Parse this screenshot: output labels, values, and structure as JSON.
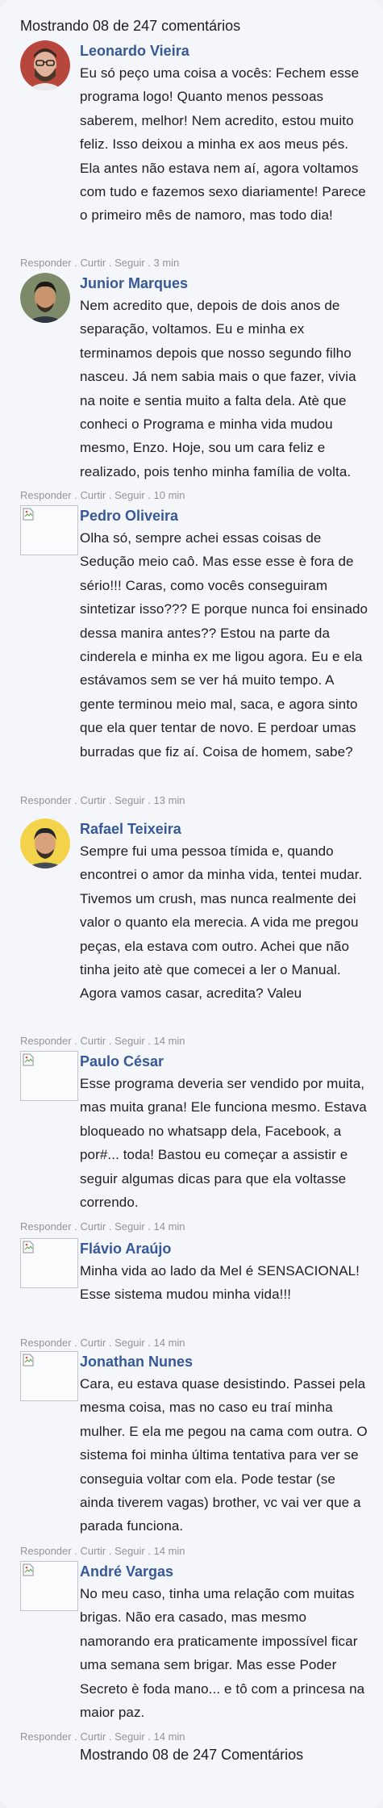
{
  "header": {
    "text": "Mostrando 08 de 247 comentários"
  },
  "footer": {
    "text": "Mostrando 08 de 247 Comentários"
  },
  "meta_actions": {
    "reply": "Responder",
    "like": "Curtir",
    "follow": "Seguir",
    "sep": " . "
  },
  "comments": [
    {
      "name": "Leonardo Vieira",
      "avatar": "photo-man-glasses-beard",
      "text": "Eu só peço uma coisa a vocês: Fechem esse programa logo! Quanto menos pessoas saberem, melhor! Nem acredito, estou muito feliz. Isso deixou a minha ex aos meus pés. Ela antes não estava nem aí, agora voltamos com tudo e fazemos sexo diariamente! Parece o primeiro mês de namoro, mas todo dia!",
      "time": "3 min"
    },
    {
      "name": "Junior Marques",
      "avatar": "photo-man-dark-hair",
      "text": "Nem acredito que, depois de dois anos de separação, voltamos. Eu e minha ex terminamos depois que nosso segundo filho nasceu. Já nem sabia mais o que fazer, vivia na noite e sentia muito a falta dela. Atè que conheci o Programa e minha vida mudou mesmo, Enzo. Hoje, sou um cara feliz e realizado, pois tenho minha família de volta.",
      "time": "10 min"
    },
    {
      "name": "Pedro Oliveira",
      "avatar": "broken-image-icon",
      "text": "Olha só, sempre achei essas coisas de Sedução meio caô. Mas esse esse è fora de sério!!! Caras, como vocês conseguiram sintetizar isso??? E porque nunca foi ensinado dessa manira antes?? Estou na parte da cinderela e minha ex me ligou agora. Eu e ela estávamos sem se ver há muito tempo. A gente terminou meio mal, saca, e agora sinto que ela quer tentar de novo. E perdoar umas burradas que fiz aí. Coisa de homem, sabe?",
      "time": "13 min"
    },
    {
      "name": "Rafael Teixeira",
      "avatar": "photo-man-yellow-background",
      "text": "Sempre fui uma pessoa tímida e, quando encontrei o amor da minha vida, tentei mudar. Tivemos um crush, mas nunca realmente dei valor o quanto ela merecia. A vida me pregou peças, ela estava com outro. Achei que não tinha jeito atè que comecei a ler o Manual. Agora vamos casar, acredita? Valeu",
      "time": "14 min"
    },
    {
      "name": "Paulo César",
      "avatar": "broken-image-icon",
      "text": "Esse programa deveria ser vendido por muita, mas muita grana! Ele funciona mesmo. Estava bloqueado no whatsapp dela, Facebook, a por#... toda! Bastou eu começar a assistir e seguir algumas dicas para que ela voltasse correndo.",
      "time": "14 min"
    },
    {
      "name": "Flávio Araújo",
      "avatar": "broken-image-icon",
      "text": "Minha vida ao lado da Mel é SENSACIONAL! Esse sistema mudou minha vida!!!",
      "time": "14 min"
    },
    {
      "name": "Jonathan Nunes",
      "avatar": "broken-image-icon",
      "text": "Cara, eu estava quase desistindo. Passei pela mesma coisa, mas no caso eu traí minha mulher. E ela me pegou na cama com outra. O sistema foi minha última tentativa para ver se conseguia voltar com ela. Pode testar (se ainda tiverem vagas) brother, vc vai ver que a parada funciona.",
      "time": "14 min"
    },
    {
      "name": "André Vargas",
      "avatar": "broken-image-icon",
      "text": "No meu caso, tinha uma relação com muitas brigas. Não era casado, mas mesmo namorando era praticamente impossível ficar uma semana sem brigar. Mas esse Poder Secreto è foda mano... e tô com a princesa na maior paz.",
      "time": "14 min"
    }
  ]
}
